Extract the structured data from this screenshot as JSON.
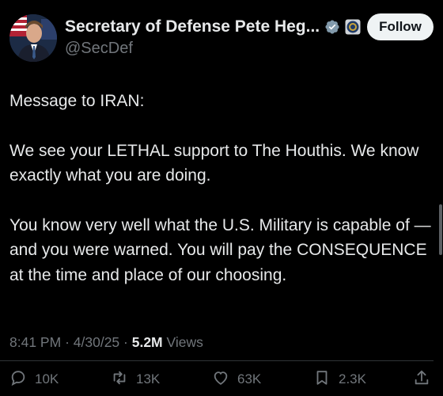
{
  "author": {
    "display_name": "Secretary of Defense Pete Heg...",
    "handle": "@SecDef",
    "verified_color": "#829aab"
  },
  "follow_label": "Follow",
  "tweet": {
    "paragraphs": [
      "Message to IRAN:",
      "We see your LETHAL support to The Houthis. We know exactly what you are doing.",
      "You know very well what the U.S. Military is capable of — and you were warned. You will pay the CONSEQUENCE at the time and place of our choosing."
    ]
  },
  "meta": {
    "time": "8:41 PM",
    "date": "4/30/25",
    "views_count": "5.2M",
    "views_label": "Views"
  },
  "actions": {
    "replies": "10K",
    "reposts": "13K",
    "likes": "63K",
    "bookmarks": "2.3K"
  }
}
